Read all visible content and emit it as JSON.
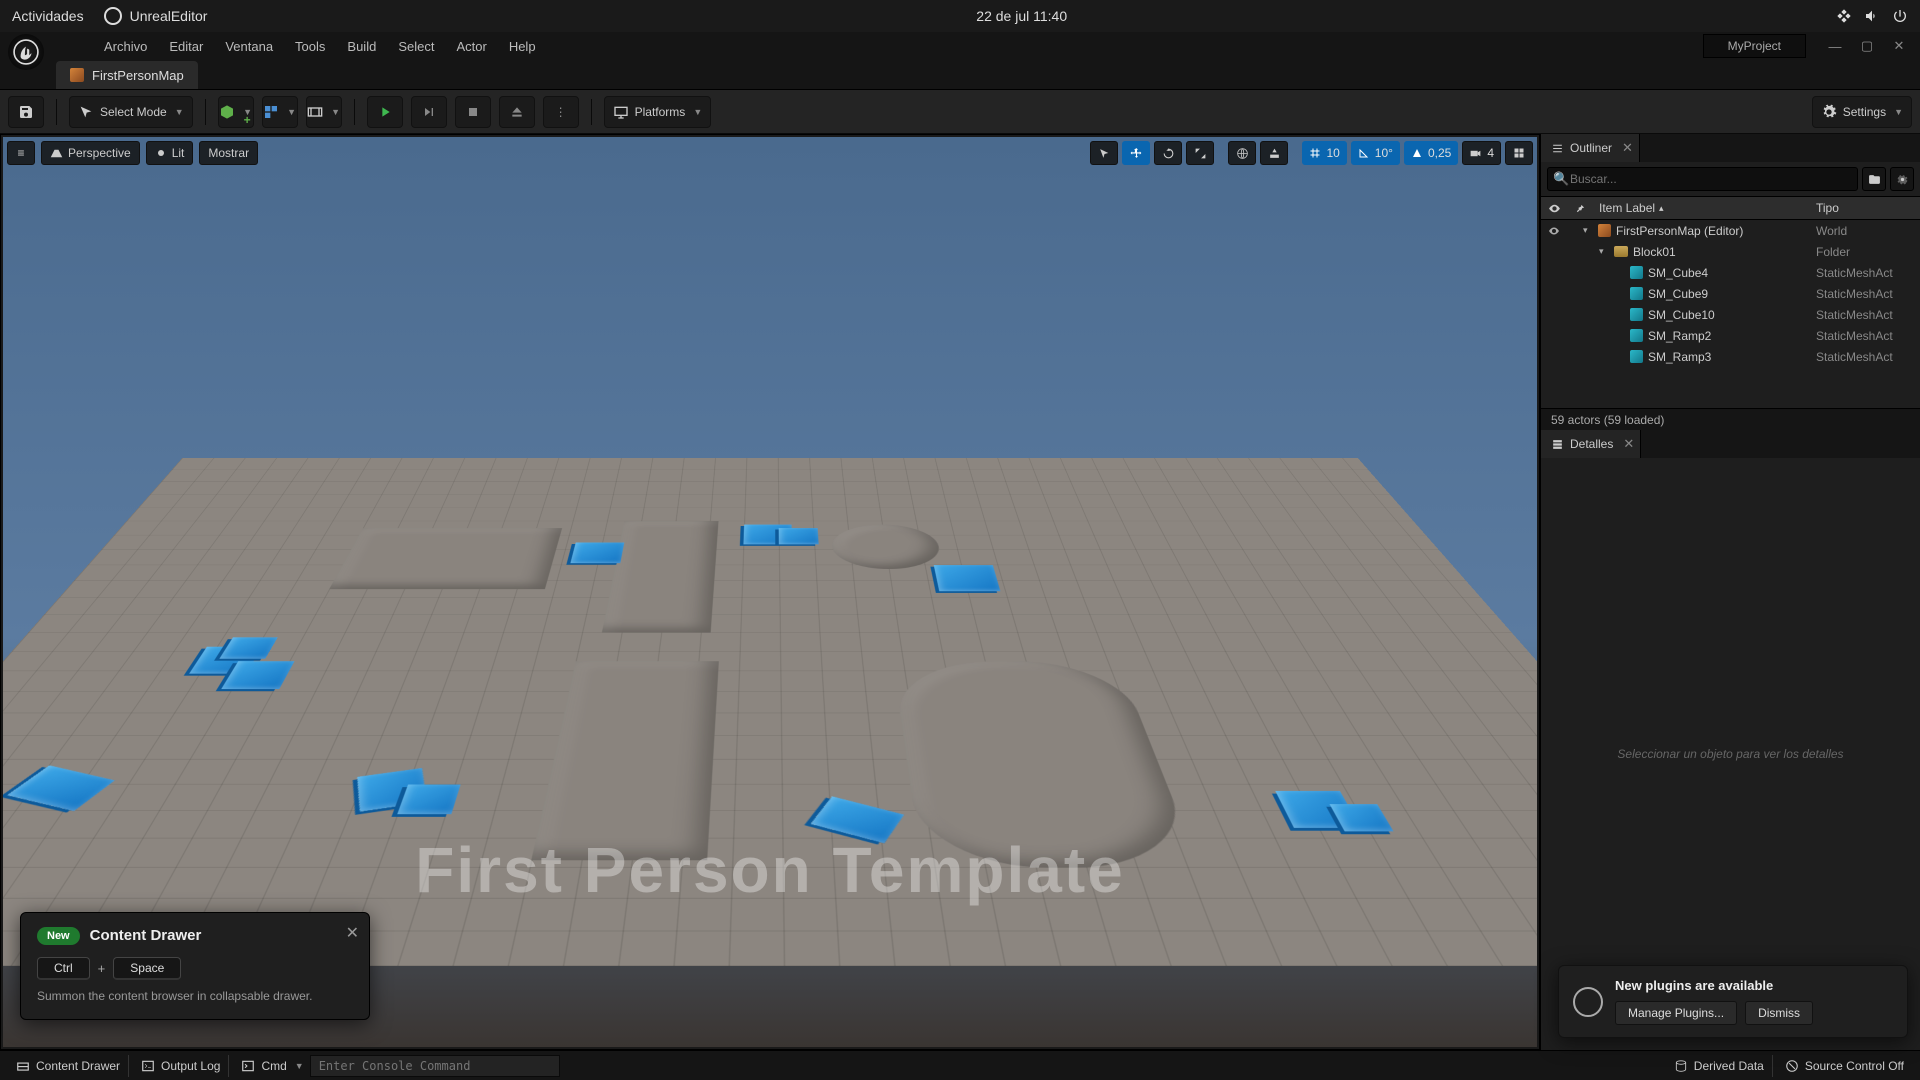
{
  "gnome": {
    "activities": "Actividades",
    "app": "UnrealEditor",
    "clock": "22 de jul  11:40"
  },
  "title": {
    "project": "MyProject"
  },
  "menu": {
    "file": "Archivo",
    "edit": "Editar",
    "window": "Ventana",
    "tools": "Tools",
    "build": "Build",
    "select": "Select",
    "actor": "Actor",
    "help": "Help"
  },
  "tab": {
    "map": "FirstPersonMap"
  },
  "toolbar": {
    "mode": "Select Mode",
    "platforms": "Platforms",
    "settings": "Settings"
  },
  "viewport": {
    "menu": "≡",
    "perspective": "Perspective",
    "lit": "Lit",
    "show": "Mostrar",
    "grid_snap": "10",
    "angle_snap": "10°",
    "scale_snap": "0,25",
    "cam_speed": "4",
    "template_text": "First Person Template"
  },
  "outliner": {
    "title": "Outliner",
    "search_ph": "Buscar...",
    "col_item": "Item Label",
    "col_type": "Tipo",
    "rows": [
      {
        "indent": 1,
        "icon": "map",
        "tri": "▾",
        "label": "FirstPersonMap (Editor)",
        "type": "World",
        "eye": true
      },
      {
        "indent": 2,
        "icon": "folder",
        "tri": "▾",
        "label": "Block01",
        "type": "Folder"
      },
      {
        "indent": 3,
        "icon": "mesh",
        "label": "SM_Cube4",
        "type": "StaticMeshAct"
      },
      {
        "indent": 3,
        "icon": "mesh",
        "label": "SM_Cube9",
        "type": "StaticMeshAct"
      },
      {
        "indent": 3,
        "icon": "mesh",
        "label": "SM_Cube10",
        "type": "StaticMeshAct"
      },
      {
        "indent": 3,
        "icon": "mesh",
        "label": "SM_Ramp2",
        "type": "StaticMeshAct"
      },
      {
        "indent": 3,
        "icon": "mesh",
        "label": "SM_Ramp3",
        "type": "StaticMeshAct"
      }
    ],
    "status": "59 actors (59 loaded)"
  },
  "details": {
    "title": "Detalles",
    "empty": "Seleccionar un objeto para ver los detalles"
  },
  "statusbar": {
    "drawer": "Content Drawer",
    "output": "Output Log",
    "cmd_label": "Cmd",
    "cmd_ph": "Enter Console Command",
    "derived": "Derived Data",
    "source": "Source Control Off"
  },
  "hint": {
    "badge": "New",
    "title": "Content Drawer",
    "k1": "Ctrl",
    "k2": "Space",
    "desc": "Summon the content browser in collapsable drawer."
  },
  "plugins": {
    "title": "New plugins are available",
    "manage": "Manage Plugins...",
    "dismiss": "Dismiss"
  }
}
